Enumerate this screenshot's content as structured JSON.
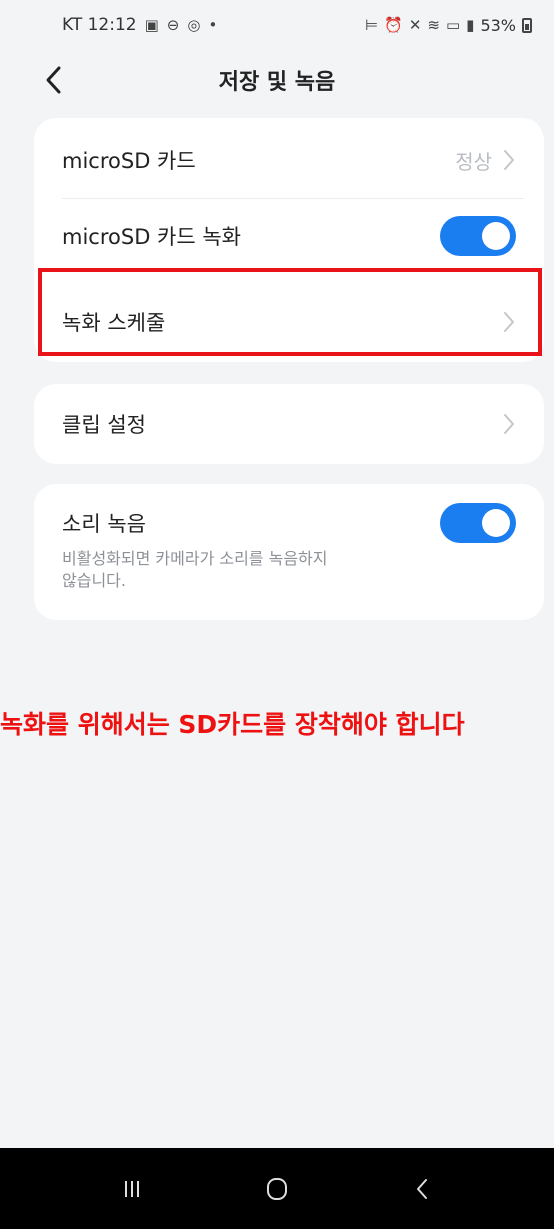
{
  "status_bar": {
    "carrier_time": "KT 12:12",
    "left_icons": [
      "gallery-icon",
      "dnd-icon",
      "watch-icon",
      "dot-icon"
    ],
    "right_icons": [
      "sleep-icon",
      "alarm-icon",
      "mute-icon",
      "wifi-icon",
      "hd-icon",
      "signal-icon"
    ],
    "battery": "53%"
  },
  "header": {
    "title": "저장 및 녹음"
  },
  "card1": {
    "rows": [
      {
        "label": "microSD 카드",
        "value": "정상"
      },
      {
        "label": "microSD 카드 녹화",
        "toggle": true
      },
      {
        "label": "녹화 스케줄"
      }
    ]
  },
  "card2": {
    "label": "클립 설정"
  },
  "card3": {
    "label": "소리 녹음",
    "description_line1": "비활성화되면 카메라가 소리를 녹음하지",
    "description_line2": "않습니다.",
    "toggle": true
  },
  "annotation": "녹화를 위해서는 SD카드를 장착해야 합니다",
  "colors": {
    "accent": "#1a7df0",
    "highlight": "#e8141a",
    "annotation": "#ee1111",
    "background": "#f3f4f6"
  }
}
